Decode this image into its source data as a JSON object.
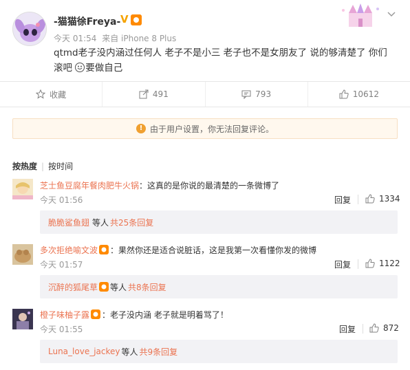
{
  "post": {
    "username": "-猫猫徐Freya-",
    "v_badge": "V",
    "time": "今天 01:54",
    "source": "来自 iPhone 8 Plus",
    "text_line1": "qtmd老子没内涵过任何人 老子不是小三 老子也不是女朋友了 说的够清楚了 你们",
    "text_line2_prefix": "滚吧",
    "text_line2_suffix": "要做自己"
  },
  "actions": [
    {
      "icon": "star-icon",
      "label": "收藏"
    },
    {
      "icon": "forward-icon",
      "label": "491"
    },
    {
      "icon": "comment-icon",
      "label": "793"
    },
    {
      "icon": "thumbs-up-icon",
      "label": "10612"
    }
  ],
  "notice": {
    "text": "由于用户设置，你无法回复评论。"
  },
  "sort": {
    "active": "按热度",
    "inactive": "按时间"
  },
  "comments": [
    {
      "name": "芝士鱼豆腐年餐肉肥牛火锅",
      "text": "：这真的是你说的最清楚的一条微博了",
      "time": "今天 01:56",
      "reply": "回复",
      "likes": "1334",
      "sub_user": "脆脆鲨鱼翅",
      "sub_mid": "等人",
      "sub_count": "共25条回复"
    },
    {
      "name": "多次拒绝喻文波",
      "text": "：果然你还是适合说脏话，这是我第一次看懂你发的微博",
      "time": "今天 01:57",
      "reply": "回复",
      "likes": "1122",
      "sub_user": "沉醉的狐尾草",
      "sub_mid": "等人",
      "sub_count": "共8条回复"
    },
    {
      "name": "橙子味柚子露",
      "text": "：老子没内涵 老子就是明着骂了！",
      "time": "今天 01:55",
      "reply": "回复",
      "likes": "872",
      "sub_user": "Luna_love_jackey",
      "sub_mid": "等人",
      "sub_count": "共9条回复"
    }
  ],
  "colors": {
    "accent": "#eb7350",
    "notice_bg": "#fff8ee",
    "sub_bg": "#f2f2f5"
  }
}
